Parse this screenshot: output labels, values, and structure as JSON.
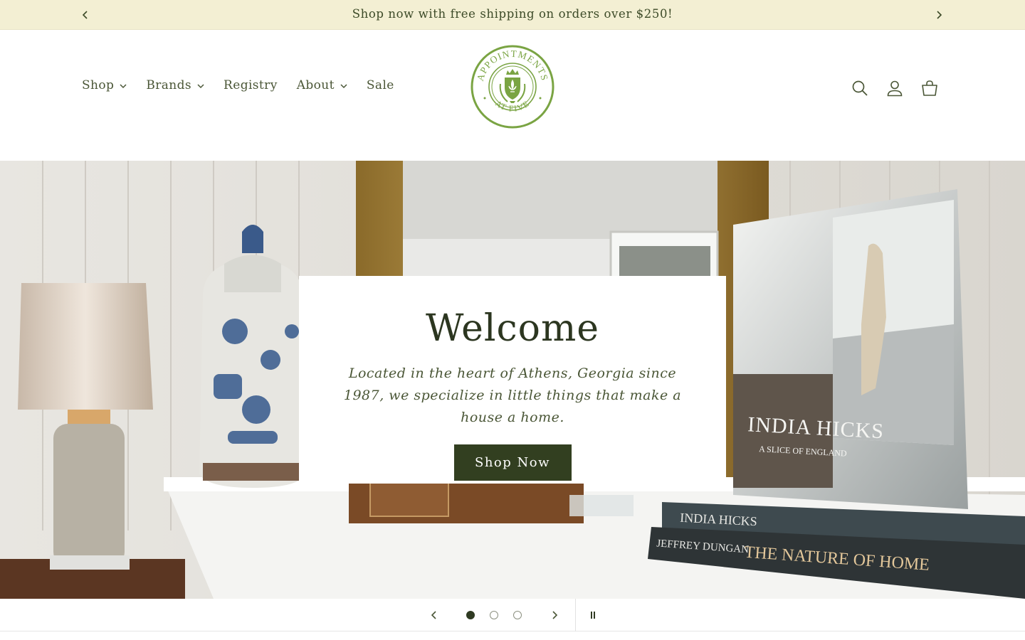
{
  "announcement": {
    "message": "Shop now with free shipping on orders over $250!",
    "prev_icon": "chevron-left-icon",
    "next_icon": "chevron-right-icon"
  },
  "header": {
    "nav": [
      {
        "label": "Shop",
        "has_dropdown": true
      },
      {
        "label": "Brands",
        "has_dropdown": true
      },
      {
        "label": "Registry",
        "has_dropdown": false
      },
      {
        "label": "About",
        "has_dropdown": true
      },
      {
        "label": "Sale",
        "has_dropdown": false
      }
    ],
    "logo": {
      "top_text": "APPOINTMENTS",
      "bottom_text": "AT FIVE",
      "color": "#7aa443"
    },
    "icons": [
      "search-icon",
      "account-icon",
      "cart-icon"
    ]
  },
  "hero": {
    "title": "Welcome",
    "subtitle": "Located in the heart of Athens, Georgia since 1987, we specialize in little things that make a house a home.",
    "button_label": "Shop Now",
    "image_book_texts": {
      "book1_title": "INDIA HICKS",
      "book1_subtitle": "A SLICE OF ENGLAND",
      "book2_author": "JEFFREY DUNGAN",
      "book2_title": "THE NATURE OF HOME"
    }
  },
  "slider": {
    "slide_count": 3,
    "active_index": 0,
    "prev_icon": "chevron-left-icon",
    "next_icon": "chevron-right-icon",
    "pause_icon": "pause-icon"
  },
  "colors": {
    "announcement_bg": "#f3efd3",
    "accent_dark_green": "#323f20",
    "logo_green": "#7aa443",
    "text": "#4a5636"
  }
}
